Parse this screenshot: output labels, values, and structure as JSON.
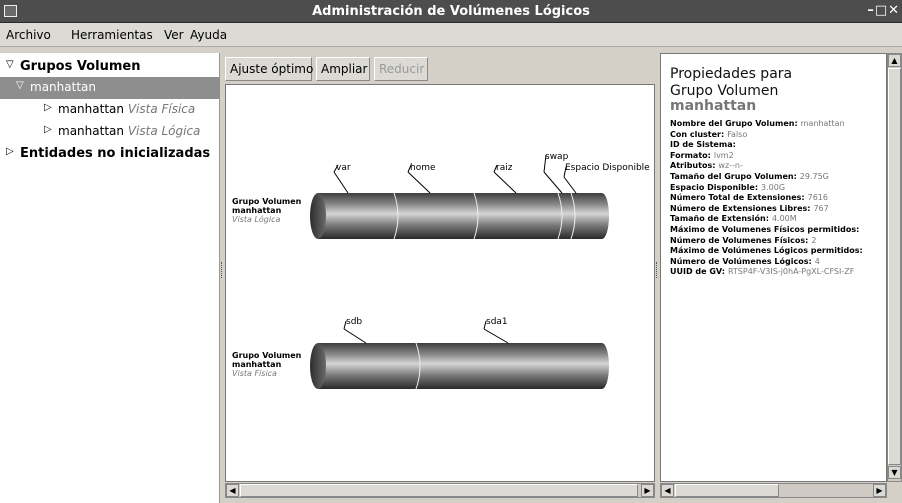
{
  "window": {
    "title": "Administración de Volúmenes Lógicos",
    "controls": "–□✕"
  },
  "menu": {
    "archivo": "Archivo",
    "herramientas": "Herramientas",
    "ver": "Ver",
    "ayuda": "Ayuda"
  },
  "tree": {
    "groups": "Grupos Volumen",
    "group_name": "manhattan",
    "phys_name": "manhattan",
    "phys_view": "Vista Física",
    "log_name": "manhattan",
    "log_view": "Vista Lógica",
    "uninit": "Entidades no inicializadas"
  },
  "toolbar": {
    "fit": "Ajuste óptimo",
    "zoom_in": "Ampliar",
    "zoom_out": "Reducir"
  },
  "canvas": {
    "logical": {
      "label_line1": "Grupo Volumen",
      "label_line2": "manhattan",
      "label_line3": "Vista Lógica",
      "segments": [
        "var",
        "home",
        "raiz",
        "swap",
        "Espacio Disponible"
      ]
    },
    "physical": {
      "label_line1": "Grupo Volumen",
      "label_line2": "manhattan",
      "label_line3": "Vista Física",
      "segments": [
        "sdb",
        "sda1"
      ]
    }
  },
  "props": {
    "heading1": "Propiedades para",
    "heading2": "Grupo Volumen",
    "name": "manhattan",
    "rows": [
      {
        "k": "Nombre del Grupo Volumen:",
        "v": "manhattan"
      },
      {
        "k": "Con cluster:",
        "v": "Falso"
      },
      {
        "k": "ID de Sistema:",
        "v": ""
      },
      {
        "k": "Formato:",
        "v": "lvm2"
      },
      {
        "k": "Atributos:",
        "v": "wz--n-"
      },
      {
        "k": "Tamaño del Grupo Volumen:",
        "v": "29.75G"
      },
      {
        "k": "Espacio Disponible:",
        "v": "3.00G"
      },
      {
        "k": "Número Total de Extensiones:",
        "v": "7616"
      },
      {
        "k": "Número de Extensiones Libres:",
        "v": "767"
      },
      {
        "k": "Tamaño de Extensión:",
        "v": "4.00M"
      },
      {
        "k": "Máximo de Volumenes Físicos permitidos:",
        "v": ""
      },
      {
        "k": "Número de Volumenes Físicos:",
        "v": "2"
      },
      {
        "k": "Máximo de Volúmenes Lógicos permitidos:",
        "v": ""
      },
      {
        "k": "Número de Volúmenes Lógicos:",
        "v": "4"
      },
      {
        "k": "UUID de GV:",
        "v": "RTSP4F-V3IS-j0hA-PgXL-CFSI-ZF"
      }
    ]
  }
}
